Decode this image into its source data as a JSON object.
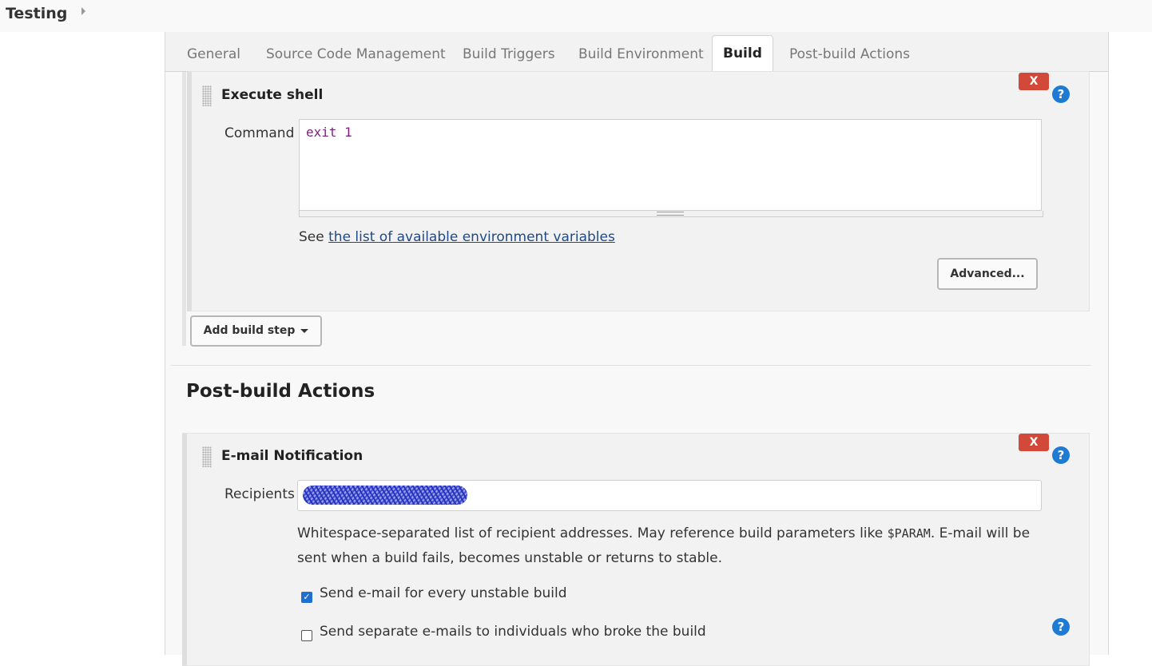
{
  "breadcrumb": {
    "job_name": "Testing"
  },
  "tabs": [
    {
      "label": "General"
    },
    {
      "label": "Source Code Management"
    },
    {
      "label": "Build Triggers"
    },
    {
      "label": "Build Environment"
    },
    {
      "label": "Build"
    },
    {
      "label": "Post-build Actions"
    }
  ],
  "active_tab": "Build",
  "execute_shell": {
    "title": "Execute shell",
    "delete_label": "X",
    "help_label": "?",
    "command_label": "Command",
    "command_value": "exit 1",
    "env_prefix": "See ",
    "env_link": "the list of available environment variables",
    "advanced_label": "Advanced..."
  },
  "add_build_step_label": "Add build step",
  "post_build": {
    "header": "Post-build Actions",
    "email": {
      "title": "E-mail Notification",
      "delete_label": "X",
      "help_label": "?",
      "recipients_label": "Recipients",
      "desc_part1": "Whitespace-separated list of recipient addresses. May reference build parameters like ",
      "desc_param": "$PARAM",
      "desc_part2": ". E-mail will be sent when a build fails, becomes unstable or returns to stable.",
      "checkbox_unstable_label": "Send e-mail for every unstable build",
      "checkbox_unstable_checked": true,
      "checkbox_individuals_label": "Send separate e-mails to individuals who broke the build",
      "checkbox_individuals_checked": false,
      "individuals_help_label": "?"
    }
  },
  "colors": {
    "delete": "#d24939",
    "help": "#1e7bd4",
    "link": "#204a87",
    "checkbox": "#1e6fd0"
  }
}
